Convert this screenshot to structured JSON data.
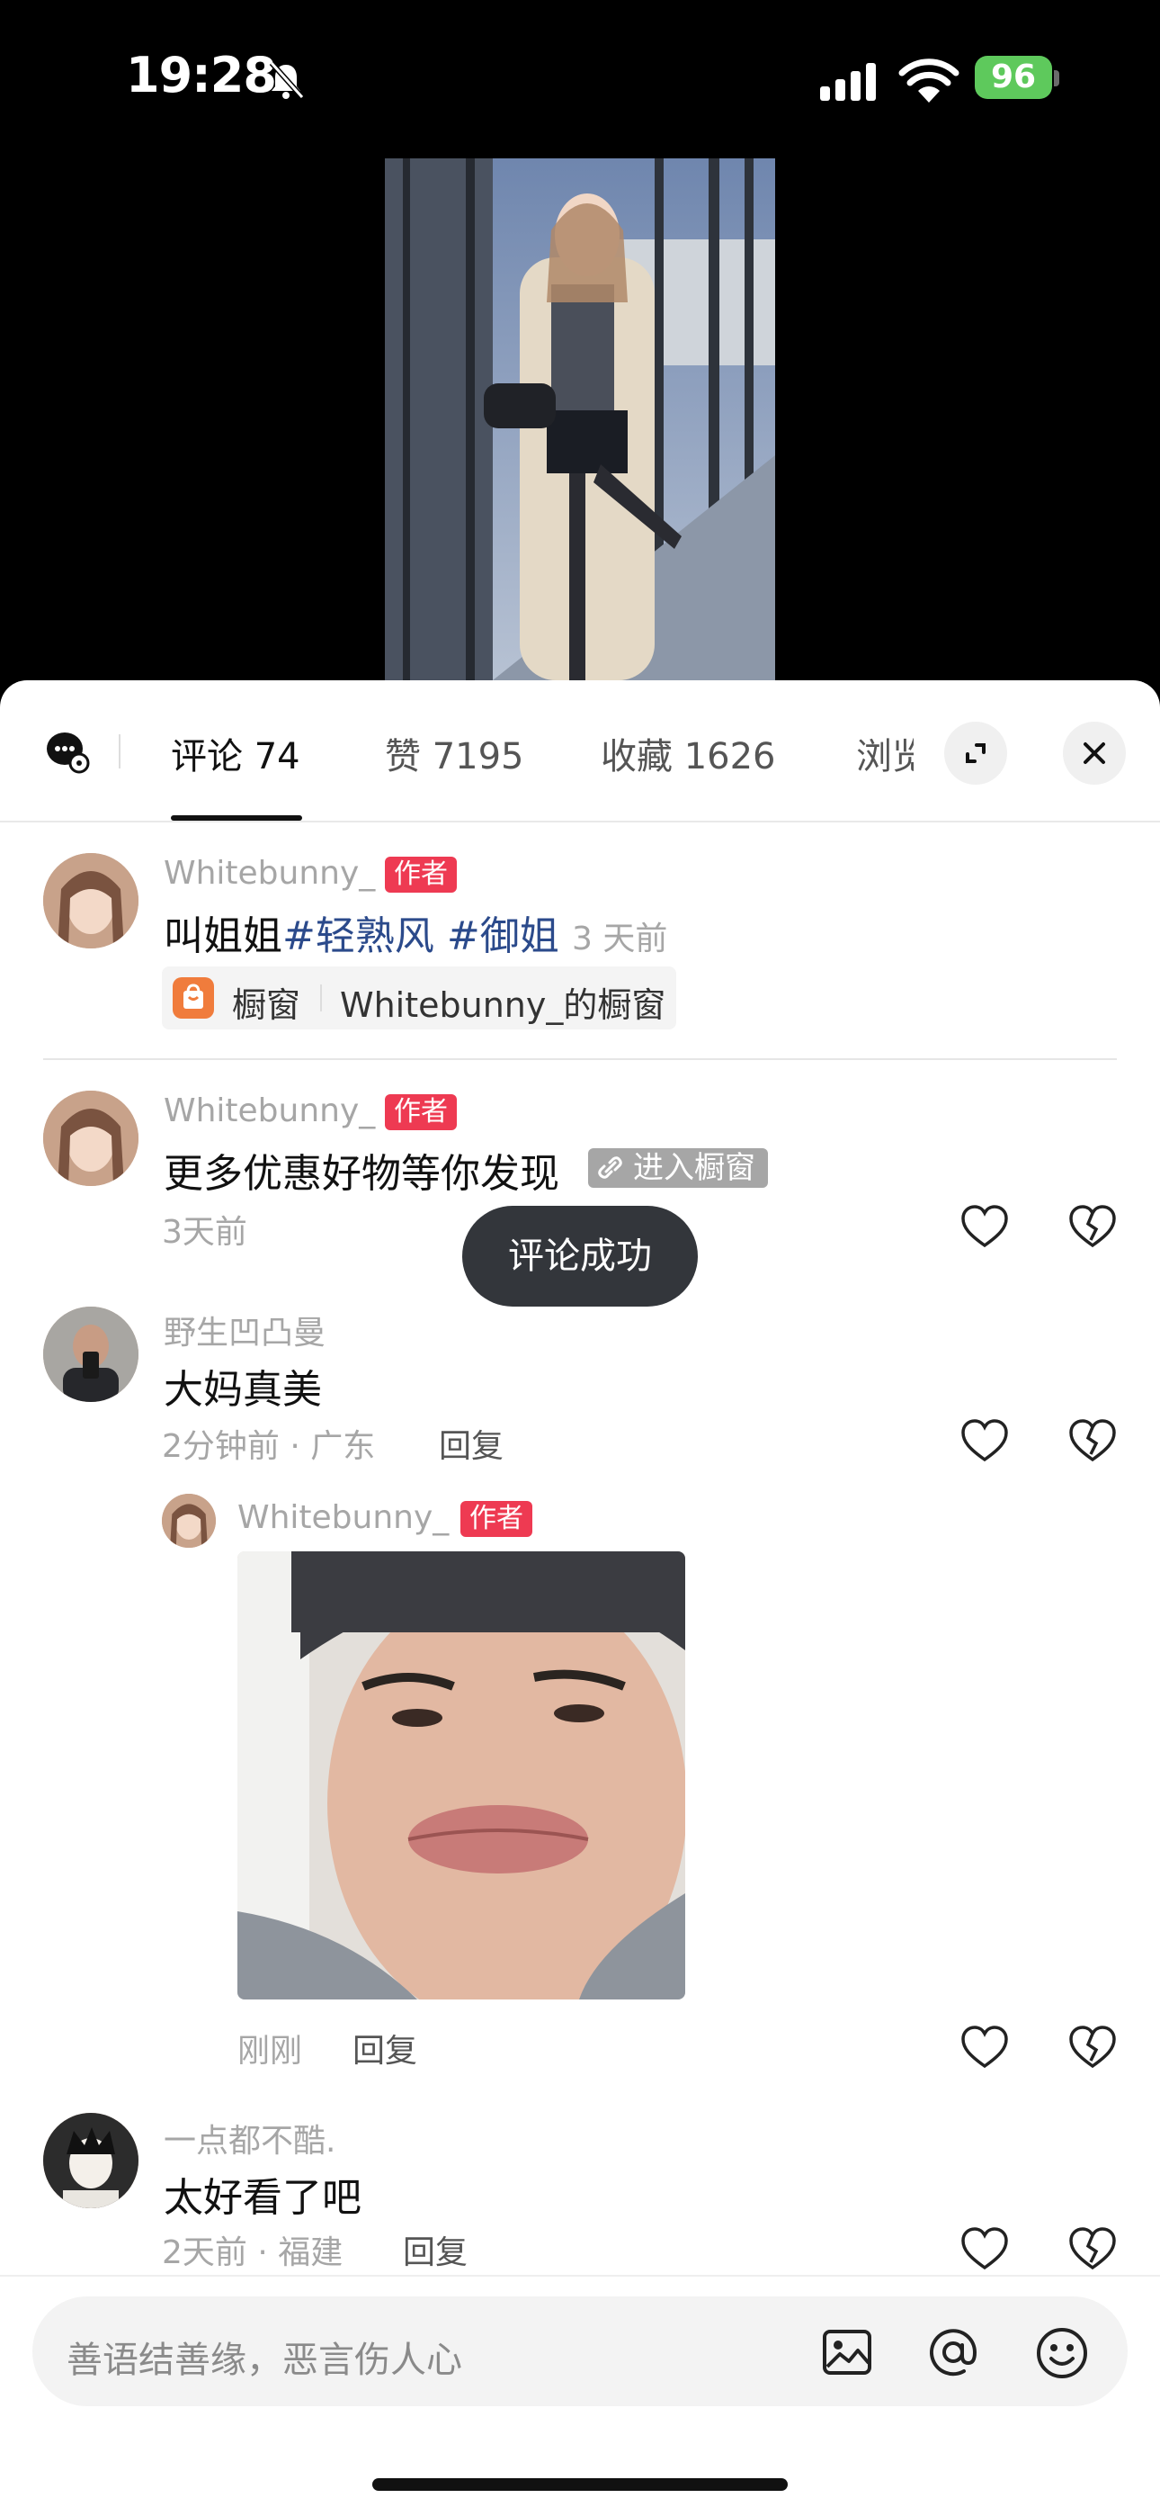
{
  "status_bar": {
    "time": "19:28",
    "battery": "96"
  },
  "tabs": {
    "comments": "评论 74",
    "likes": "赞 7195",
    "favorites": "收藏 1626",
    "views": "浏览"
  },
  "comments": [
    {
      "user": "Whitebunny_",
      "badge": "作者",
      "text": "叫姐姐",
      "hashtag1": "#轻熟风",
      "hashtag2": "#御姐",
      "time": "3 天前",
      "shop_label": "橱窗",
      "shop_name": "Whitebunny_的橱窗"
    },
    {
      "user": "Whitebunny_",
      "badge": "作者",
      "text": "更多优惠好物等你发现",
      "link": "进入橱窗",
      "time": "3天前"
    },
    {
      "user": "野生凹凸曼",
      "text": "大妈真美",
      "time": "2分钟前 · 广东",
      "reply": "回复"
    },
    {
      "user": "Whitebunny_",
      "badge": "作者",
      "time": "刚刚",
      "reply": "回复"
    },
    {
      "user": "一点都不酷.",
      "text": "太好看了吧",
      "time": "2天前 · 福建",
      "reply": "回复"
    }
  ],
  "toast": "评论成功",
  "input": {
    "placeholder": "善语结善缘，恶言伤人心"
  },
  "colors": {
    "author_badge": "#ee3a52",
    "hashtag": "#2b4a8b",
    "toast_bg": "#33363b"
  }
}
